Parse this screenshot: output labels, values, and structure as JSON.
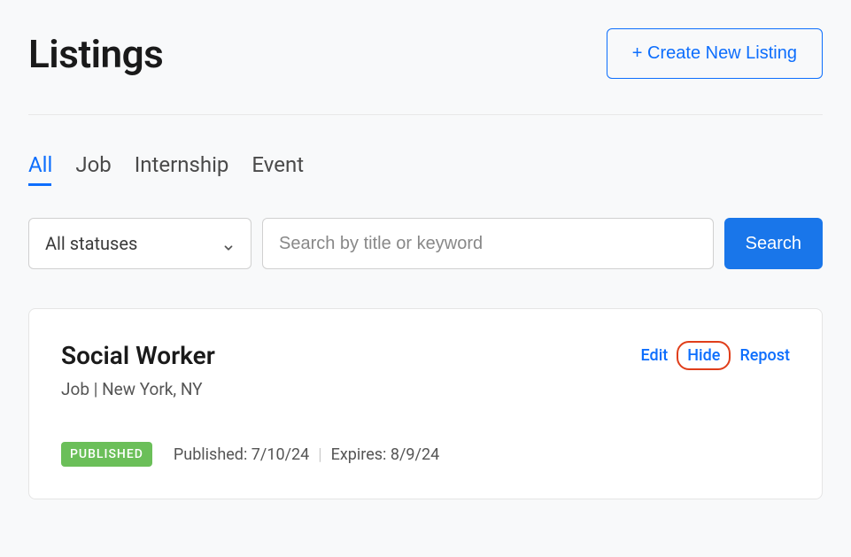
{
  "header": {
    "title": "Listings",
    "create_button_label": "+ Create New Listing"
  },
  "tabs": [
    {
      "label": "All",
      "active": true
    },
    {
      "label": "Job",
      "active": false
    },
    {
      "label": "Internship",
      "active": false
    },
    {
      "label": "Event",
      "active": false
    }
  ],
  "filters": {
    "status_select_label": "All statuses",
    "search_placeholder": "Search by title or keyword",
    "search_button_label": "Search"
  },
  "listing": {
    "title": "Social Worker",
    "type": "Job",
    "location": "New York, NY",
    "subtitle_divider": " | ",
    "status_badge": "PUBLISHED",
    "published_label": "Published: ",
    "published_date": "7/10/24",
    "expires_label": "Expires: ",
    "expires_date": "8/9/24",
    "actions": {
      "edit": "Edit",
      "hide": "Hide",
      "repost": "Repost"
    }
  }
}
